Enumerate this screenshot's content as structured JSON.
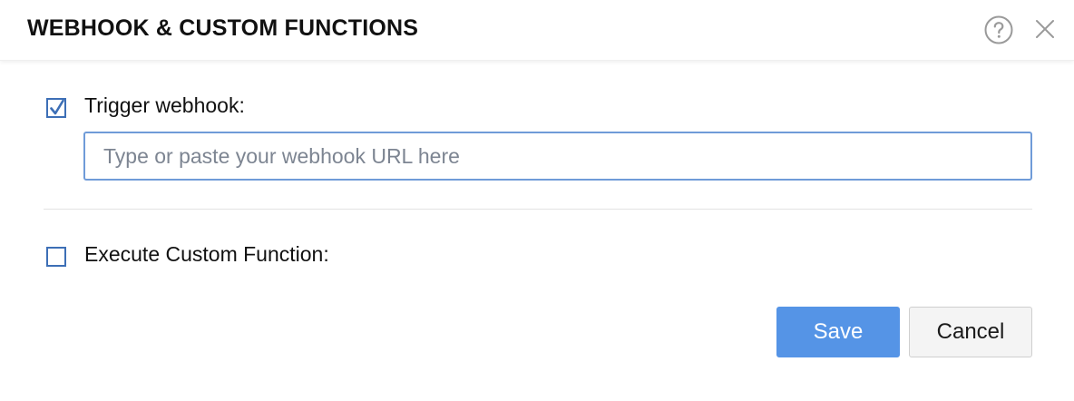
{
  "dialog": {
    "title": "WEBHOOK & CUSTOM FUNCTIONS",
    "help_icon": "question-circle-icon",
    "close_icon": "close-x-icon"
  },
  "webhook": {
    "checked": true,
    "label": "Trigger webhook:",
    "input_value": "",
    "input_placeholder": "Type or paste your webhook URL here"
  },
  "custom_function": {
    "checked": false,
    "label": "Execute Custom Function:"
  },
  "buttons": {
    "save_label": "Save",
    "cancel_label": "Cancel"
  },
  "colors": {
    "accent": "#5594e6",
    "checkbox_border": "#3d6fb6",
    "input_border": "#6f9bd8"
  }
}
